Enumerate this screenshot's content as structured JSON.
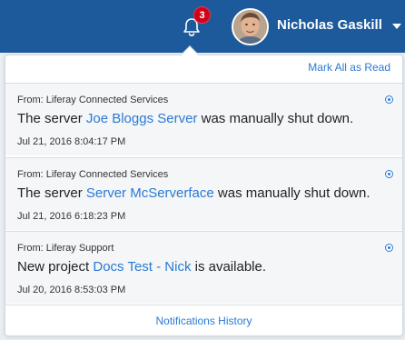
{
  "header": {
    "notification_count": "3",
    "user_name": "Nicholas Gaskill"
  },
  "panel": {
    "mark_all_label": "Mark All as Read",
    "history_label": "Notifications History",
    "notifications": [
      {
        "from": "From: Liferay Connected Services",
        "text_before": "The server ",
        "link": "Joe Bloggs Server",
        "text_after": " was manually shut down.",
        "date": "Jul 21, 2016 8:04:17 PM"
      },
      {
        "from": "From: Liferay Connected Services",
        "text_before": "The server ",
        "link": "Server McServerface",
        "text_after": " was manually shut down.",
        "date": "Jul 21, 2016 6:18:23 PM"
      },
      {
        "from": "From: Liferay Support",
        "text_before": "New project ",
        "link": "Docs Test - Nick",
        "text_after": " is available.",
        "date": "Jul 20, 2016 8:53:03 PM"
      }
    ]
  },
  "colors": {
    "topbar": "#1c5a9b",
    "badge": "#d0021b",
    "link": "#2a7ad4"
  },
  "icons": [
    "bell-icon",
    "avatar",
    "caret-down-icon",
    "unread-dot-icon"
  ]
}
